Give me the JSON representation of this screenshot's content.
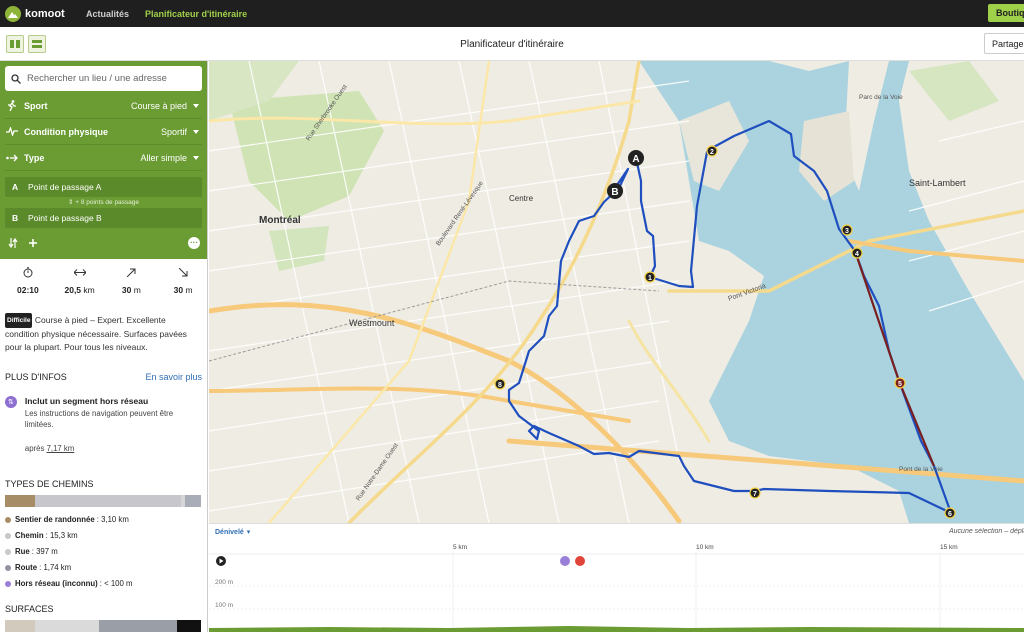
{
  "app": {
    "brand": "komoot",
    "nav": [
      {
        "label": "Actualités"
      },
      {
        "label": "Planificateur d'itinéraire"
      }
    ],
    "shop_label": "Boutique"
  },
  "header": {
    "title": "Planificateur d'itinéraire",
    "share_label": "Partager"
  },
  "planner": {
    "search_placeholder": "Rechercher un lieu / une adresse",
    "sport": {
      "label": "Sport",
      "value": "Course à pied"
    },
    "fitness": {
      "label": "Condition physique",
      "value": "Sportif"
    },
    "type": {
      "label": "Type",
      "value": "Aller simple"
    },
    "waypoint_a": {
      "letter": "A",
      "label": "Point de passage A"
    },
    "via_text": "+ 8 points de passage",
    "waypoint_b": {
      "letter": "B",
      "label": "Point de passage B"
    }
  },
  "stats": [
    {
      "icon": "stopwatch-icon",
      "value": "02:10",
      "unit": ""
    },
    {
      "icon": "distance-icon",
      "value": "20,5",
      "unit": "km"
    },
    {
      "icon": "ascent-icon",
      "value": "30",
      "unit": "m"
    },
    {
      "icon": "descent-icon",
      "value": "30",
      "unit": "m"
    }
  ],
  "description": {
    "badge": "Difficile",
    "text": "Course à pied – Expert. Excellente condition physique nécessaire. Surfaces pavées pour la plupart. Pour tous les niveaux."
  },
  "more_info": {
    "title": "PLUS D'INFOS",
    "link": "En savoir plus",
    "item_title": "Inclut un segment hors réseau",
    "item_text": "Les instructions de navigation peuvent être limitées.",
    "after_prefix": "après",
    "after_value": "7,17 km"
  },
  "way_types": {
    "title": "TYPES DE CHEMINS",
    "segments": [
      {
        "fraction": 0.151,
        "color": "#a78d65"
      },
      {
        "fraction": 0.747,
        "color": "#c6c6cc"
      },
      {
        "fraction": 0.019,
        "color": "#d6d6d6"
      },
      {
        "fraction": 0.085,
        "color": "#a9adb8"
      }
    ],
    "items": [
      {
        "name": "Sentier de randonnée",
        "value": "3,10 km",
        "color": "#a78d65"
      },
      {
        "name": "Chemin",
        "value": "15,3 km",
        "color": "#c6c6cc"
      },
      {
        "name": "Rue",
        "value": "397 m",
        "color": "#c9c9c9"
      },
      {
        "name": "Route",
        "value": "1,74 km",
        "color": "#8f949e"
      },
      {
        "name": "Hors réseau (inconnu)",
        "value": "< 100 m",
        "color": "#9a7fd8"
      }
    ]
  },
  "surfaces": {
    "title": "SURFACES",
    "segments": [
      {
        "color": "#d2cbbd"
      },
      {
        "color": "#dadada"
      },
      {
        "color": "#999ea7"
      },
      {
        "color": "#111111"
      }
    ]
  },
  "map": {
    "labels": [
      {
        "text": "Montréal"
      },
      {
        "text": "Westmount"
      },
      {
        "text": "Saint-Lambert"
      },
      {
        "text": "Centre"
      },
      {
        "text": "Pont Victoria"
      },
      {
        "text": "Parc de la Voie"
      },
      {
        "text": "Pont de la Voie"
      },
      {
        "text": "Rue Notre-Dame Ouest"
      },
      {
        "text": "Boulevard René-Lévesque"
      },
      {
        "text": "Rue Sherbrooke Ouest"
      }
    ],
    "markers": [
      "A",
      "B",
      "1",
      "2",
      "3",
      "4",
      "5",
      "6",
      "7",
      "8"
    ]
  },
  "elevation": {
    "select_label": "Dénivelé",
    "no_selection": "Aucune sélection – déplacez",
    "km_ticks": [
      "5 km",
      "10 km",
      "15 km"
    ],
    "y_ticks": [
      "200 m",
      "100 m"
    ]
  }
}
